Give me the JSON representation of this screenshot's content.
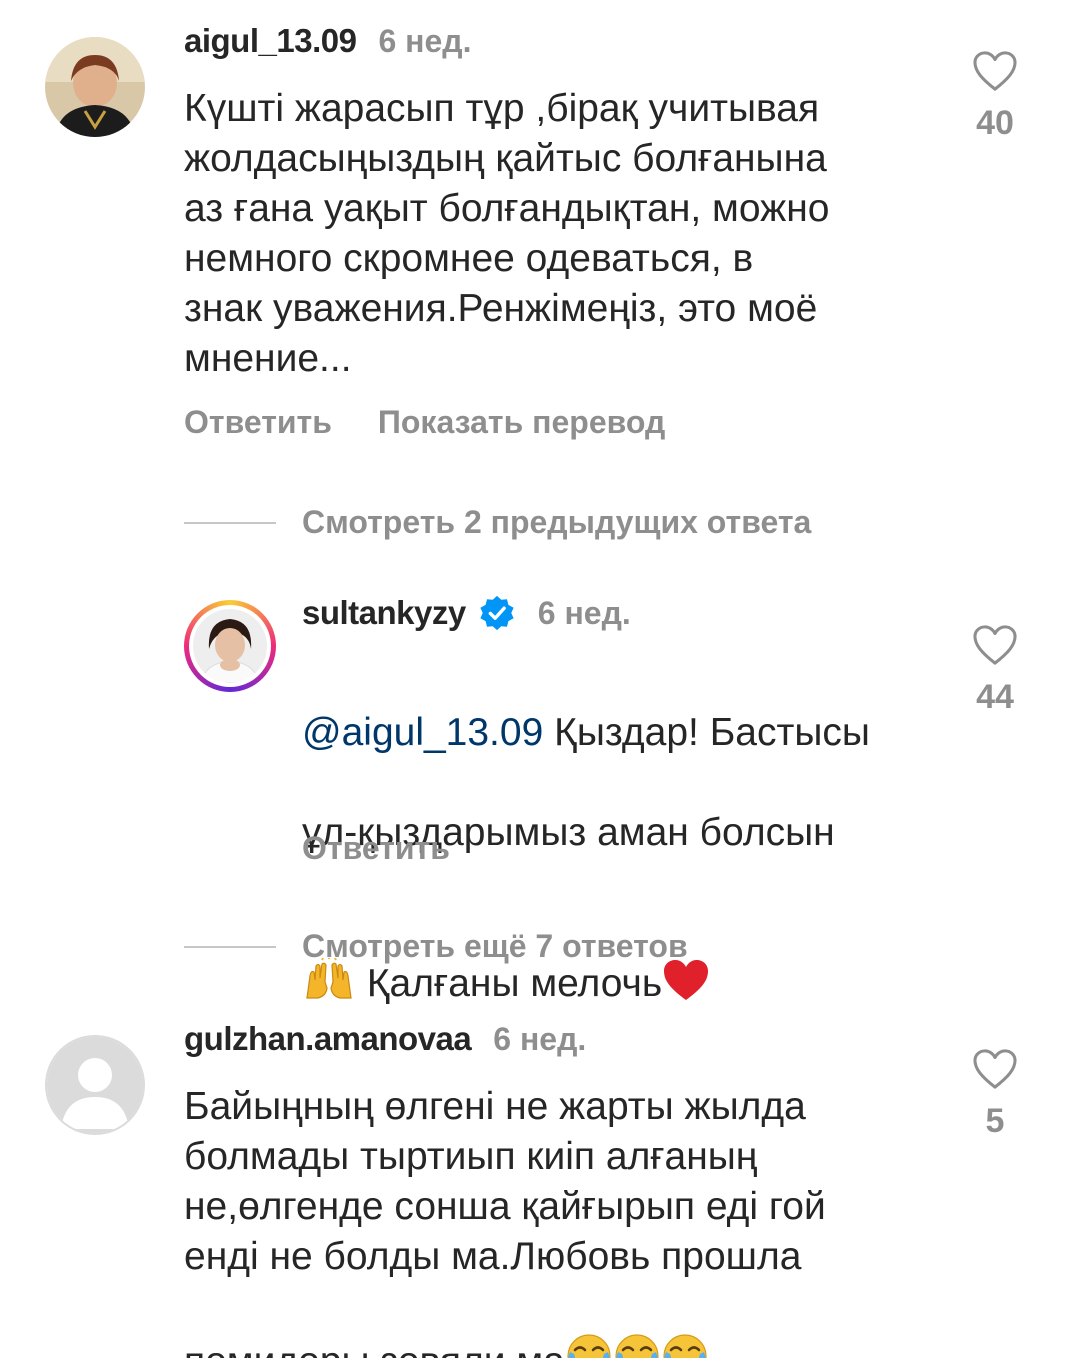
{
  "comments": [
    {
      "username": "aigul_13.09",
      "time": "6 нед.",
      "text": "Күшті жарасып тұр ,бірақ учитывая\nжолдасыңыздың қайтыс болғанына\nаз ғана уақыт болғандықтан, можно\nнемного скромнее одеваться, в\nзнак уважения.Ренжімеңіз, это моё\nмнение...",
      "likes": "40",
      "reply_label": "Ответить",
      "translate_label": "Показать перевод"
    },
    {
      "view_replies": "Смотреть 2 предыдущих ответа"
    },
    {
      "username": "sultankyzy",
      "verified": true,
      "time": "6 нед.",
      "mention": "@aigul_13.09",
      "text_line1": " Қыздар! Бастысы",
      "text_line2": "ұл-қыздарымыз аман болсын",
      "text_line3": " Қалғаны мелочь",
      "likes": "44",
      "reply_label": "Ответить"
    },
    {
      "view_replies": "Смотреть ещё 7 ответов"
    },
    {
      "username": "gulzhan.amanovaa",
      "time": "6 нед.",
      "text_main": "Байыңның өлгені не жарты жылда\nболмады тыртиып киіп алғаның\nне,өлгенде сонша қайғырып еді гой\nенді не болды ма.Любовь прошла\nпомидоры зовяли ма",
      "likes": "5"
    }
  ],
  "colors": {
    "text": "#262626",
    "secondary": "#8e8e8e",
    "mention": "#00376b",
    "verified": "#0095f6"
  }
}
